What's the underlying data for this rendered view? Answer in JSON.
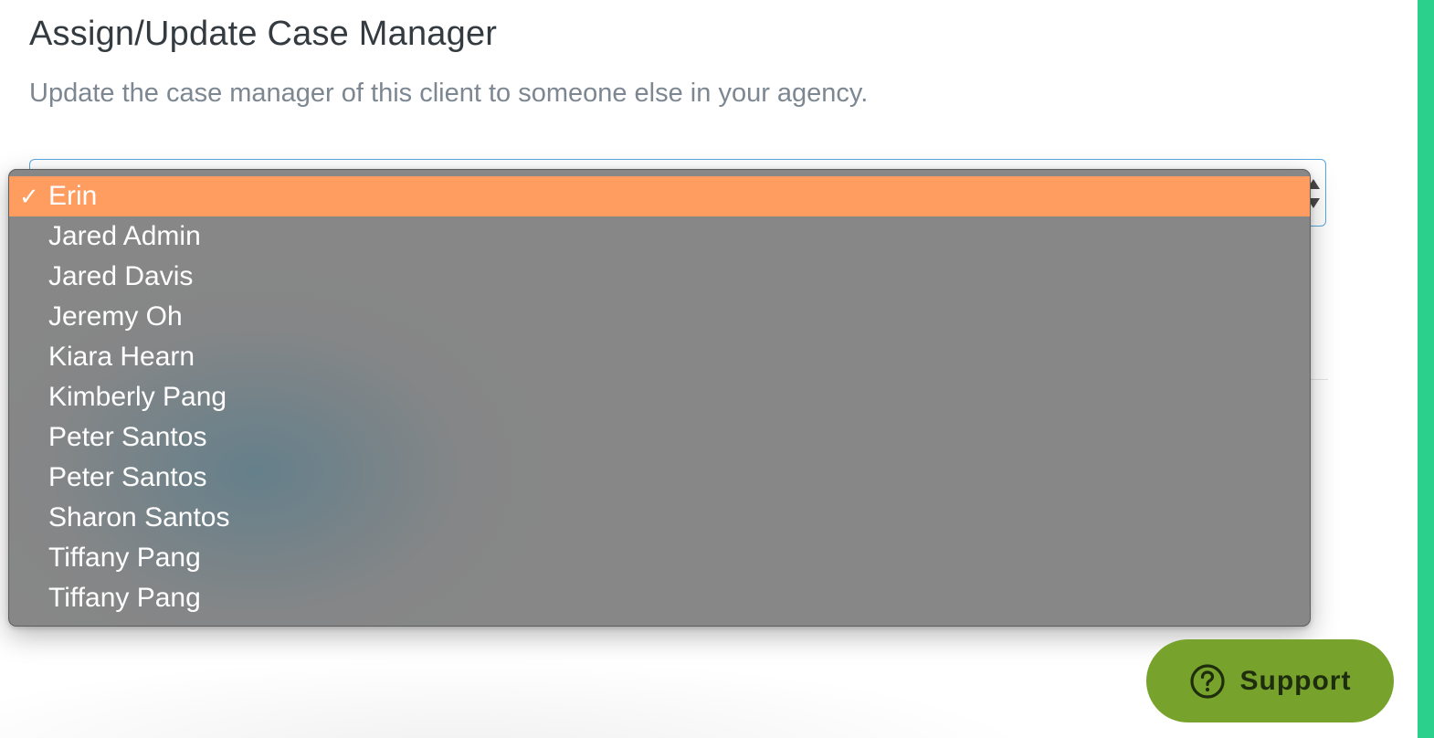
{
  "header": {
    "title": "Assign/Update Case Manager",
    "subtitle": "Update the case manager of this client to someone else in your agency."
  },
  "case_manager_select": {
    "selected": "Erin",
    "options": [
      "Erin",
      "Jared Admin",
      "Jared Davis",
      "Jeremy Oh",
      "Kiara Hearn",
      "Kimberly Pang",
      "Peter Santos",
      "Peter Santos",
      "Sharon Santos",
      "Tiffany Pang",
      "Tiffany Pang"
    ],
    "checkmark": "✓"
  },
  "support": {
    "label": "Support",
    "icon": "question-circle-icon"
  },
  "colors": {
    "selected_option": "#ff9d60",
    "dropdown_bg": "#878787",
    "select_border": "#5aa7dd",
    "support_button": "#77a22b",
    "right_accent": "#2bd08c"
  }
}
